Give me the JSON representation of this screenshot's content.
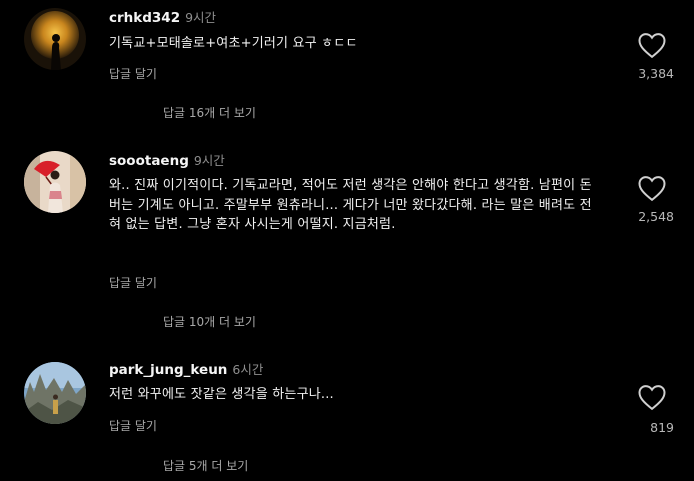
{
  "comments": [
    {
      "username": "crhkd342",
      "time": "9시간",
      "text": "기독교+모태솔로+여초+기러기 요구 ㅎㄷㄷ",
      "reply_label": "답글 달기",
      "view_replies": "답글 16개 더 보기",
      "likes": "3,384",
      "avatar_icon": "moon-silhouette-avatar"
    },
    {
      "username": "soootaeng",
      "time": "9시간",
      "text": "와.. 진짜 이기적이다. 기독교라면, 적어도 저런 생각은 안해야 한다고 생각함. 남편이 돈버는 기계도 아니고. 주말부부 원츄라니... 게다가 너만 왔다갔다해. 라는 말은 배려도 전혀 없는 답변. 그냥 혼자 사시는게 어떨지. 지금처럼.",
      "reply_label": "답글 달기",
      "view_replies": "답글 10개 더 보기",
      "likes": "2,548",
      "avatar_icon": "red-umbrella-avatar"
    },
    {
      "username": "park_jung_keun",
      "time": "6시간",
      "text": "저런 와꾸에도 잣같은 생각을 하는구나...",
      "reply_label": "답글 달기",
      "view_replies": "답글 5개 더 보기",
      "likes": "819",
      "avatar_icon": "rocky-landscape-avatar"
    }
  ],
  "colors": {
    "background": "#000000",
    "text": "#f2f2f2",
    "muted": "#a8a8a8"
  }
}
